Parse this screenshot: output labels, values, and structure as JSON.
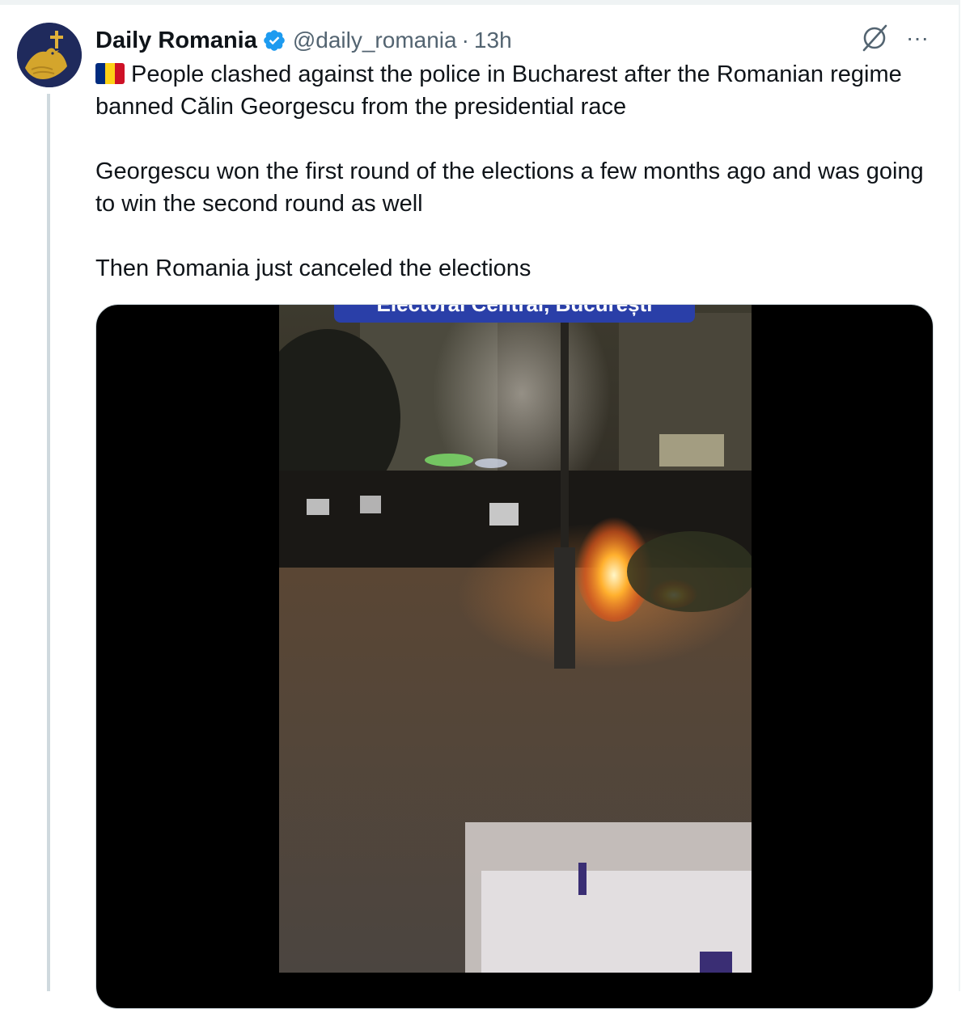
{
  "tweet": {
    "display_name": "Daily Romania",
    "verified": true,
    "handle": "@daily_romania",
    "separator": "·",
    "timestamp": "13h",
    "flag_colors": [
      "#002b7f",
      "#fcd116",
      "#ce1126"
    ],
    "paragraph_1": "People clashed against the police in Bucharest after the Romanian regime banned Călin Georgescu from the presidential race",
    "paragraph_2": "Georgescu won the first round of the elections a few months ago and was going to win the second round as well",
    "paragraph_3": "Then Romania just canceled the elections",
    "icons": {
      "verified": "verified-badge-icon",
      "grok": "grok-icon",
      "more": "more-options-icon"
    },
    "more_glyph": "···",
    "media": {
      "caption_banner": "Electoral Central, București"
    }
  },
  "colors": {
    "accent": "#1d9bf0",
    "text": "#0f1419",
    "muted": "#536471",
    "avatar_bg": "#1f2a5c",
    "avatar_bird": "#d4a52c"
  }
}
